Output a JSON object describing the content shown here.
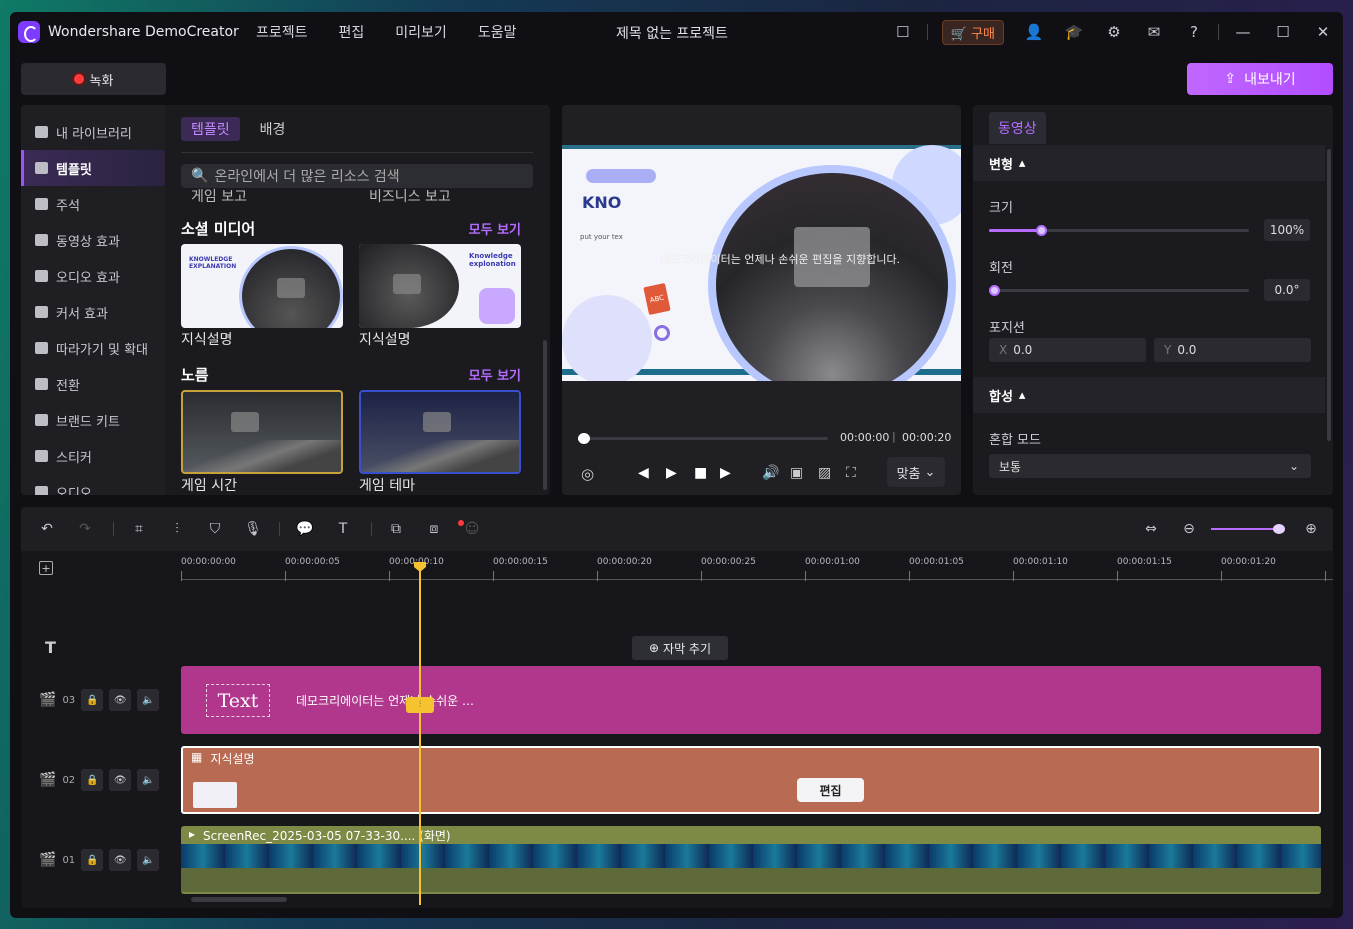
{
  "app": {
    "name": "Wondershare DemoCreator",
    "project_title": "제목 없는 프로젝트",
    "menus": [
      "프로젝트",
      "편집",
      "미리보기",
      "도움말"
    ],
    "buy": "구매"
  },
  "toolbar": {
    "record": "녹화",
    "export": "내보내기"
  },
  "sidebar": {
    "items": [
      "내 라이브러리",
      "템플릿",
      "주석",
      "동영상 효과",
      "오디오 효과",
      "커서 효과",
      "따라가기 및 확대",
      "전환",
      "브랜드 키트",
      "스티커",
      "오디오"
    ]
  },
  "library": {
    "tabs": [
      "템플릿",
      "배경"
    ],
    "search_placeholder": "온라인에서 더 많은 리소스 검색",
    "partial_captions": [
      "게임 보고",
      "비즈니스 보고"
    ],
    "sections": [
      {
        "title": "소셜 미디어",
        "see_all": "모두 보기",
        "items": [
          "지식설명",
          "지식설명"
        ]
      },
      {
        "title": "노름",
        "see_all": "모두 보기",
        "items": [
          "게임 시간",
          "게임 테마"
        ]
      }
    ],
    "thumb_text": {
      "k1": "KNOWLEDGE EXPLANATION",
      "k2": "Knowledge explonation"
    }
  },
  "preview": {
    "kno": "KNO",
    "put": "put your tex",
    "abc": "ABC",
    "overlay": "데모크리에이터는 언제나 손쉬운 편집을 지향합니다.",
    "time_current": "00:00:00",
    "time_total": "00:00:20",
    "fit": "맞춤",
    "progress": 0.02
  },
  "props": {
    "tab": "동영상",
    "transform": "변형",
    "size_label": "크기",
    "size_value": "100%",
    "size_level": 0.2,
    "rotate_label": "회전",
    "rotate_value": "0.0°",
    "rotate_level": 0.02,
    "position_label": "포지션",
    "pos_x_label": "X",
    "pos_x": "0.0",
    "pos_y_label": "Y",
    "pos_y": "0.0",
    "composite": "합성",
    "blend_label": "혼합 모드",
    "blend_value": "보통"
  },
  "timeline": {
    "ticks": [
      "00:00:00:00",
      "00:00:00:05",
      "00:00:00:10",
      "00:00:00:15",
      "00:00:00:20",
      "00:00:00:25",
      "00:00:01:00",
      "00:00:01:05",
      "00:00:01:10",
      "00:00:01:15",
      "00:00:01:20"
    ],
    "add_subtitle": "자막 추기",
    "tracks": [
      {
        "num": "03",
        "text_chip": "Text",
        "caption": "데모크리에이터는 언제나 손쉬운 …",
        "colors": {
          "bg": "#b0378c"
        }
      },
      {
        "num": "02",
        "label": "지식설명",
        "edit": "편집",
        "colors": {
          "bg": "#b86a52"
        }
      },
      {
        "num": "01",
        "label": "ScreenRec_2025-03-05 07-33-30.... (화면)",
        "colors": {
          "bg": "#7c8a45"
        }
      }
    ]
  },
  "colors": {
    "accent": "#b56cff",
    "playhead": "#f5c230"
  }
}
